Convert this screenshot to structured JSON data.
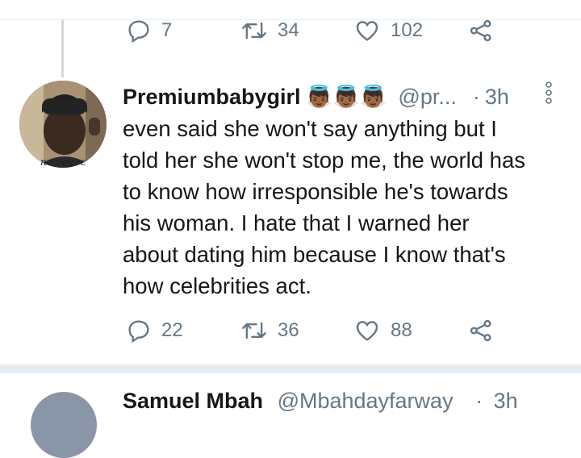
{
  "prev_tweet": {
    "reply_count": "7",
    "retweet_count": "34",
    "like_count": "102"
  },
  "tweet": {
    "display_name": "Premiumbabygirl",
    "emoji": "👼🏾👼🏾👼🏾",
    "handle": "@pr...",
    "separator": "·",
    "time": "3h",
    "avatar_caption": "no dey rc",
    "text_lines": [
      "even said she won't say anything but I",
      "told her she won't stop me, the world has",
      "to know how irresponsible he's towards",
      "his woman. I hate that I warned her",
      "about dating him because I know that's",
      "how celebrities act."
    ],
    "reply_count": "22",
    "retweet_count": "36",
    "like_count": "88"
  },
  "next_tweet": {
    "display_name": "Samuel Mbah",
    "handle": "@Mbahdayfarway",
    "separator": "·",
    "time": "3h"
  },
  "colors": {
    "icon_gray": "#657786",
    "text": "#14171a",
    "divider": "#e6ecf0",
    "thread_line": "#cfd9de"
  },
  "icons": [
    "reply-icon",
    "retweet-icon",
    "like-icon",
    "share-icon",
    "more-options-icon"
  ]
}
